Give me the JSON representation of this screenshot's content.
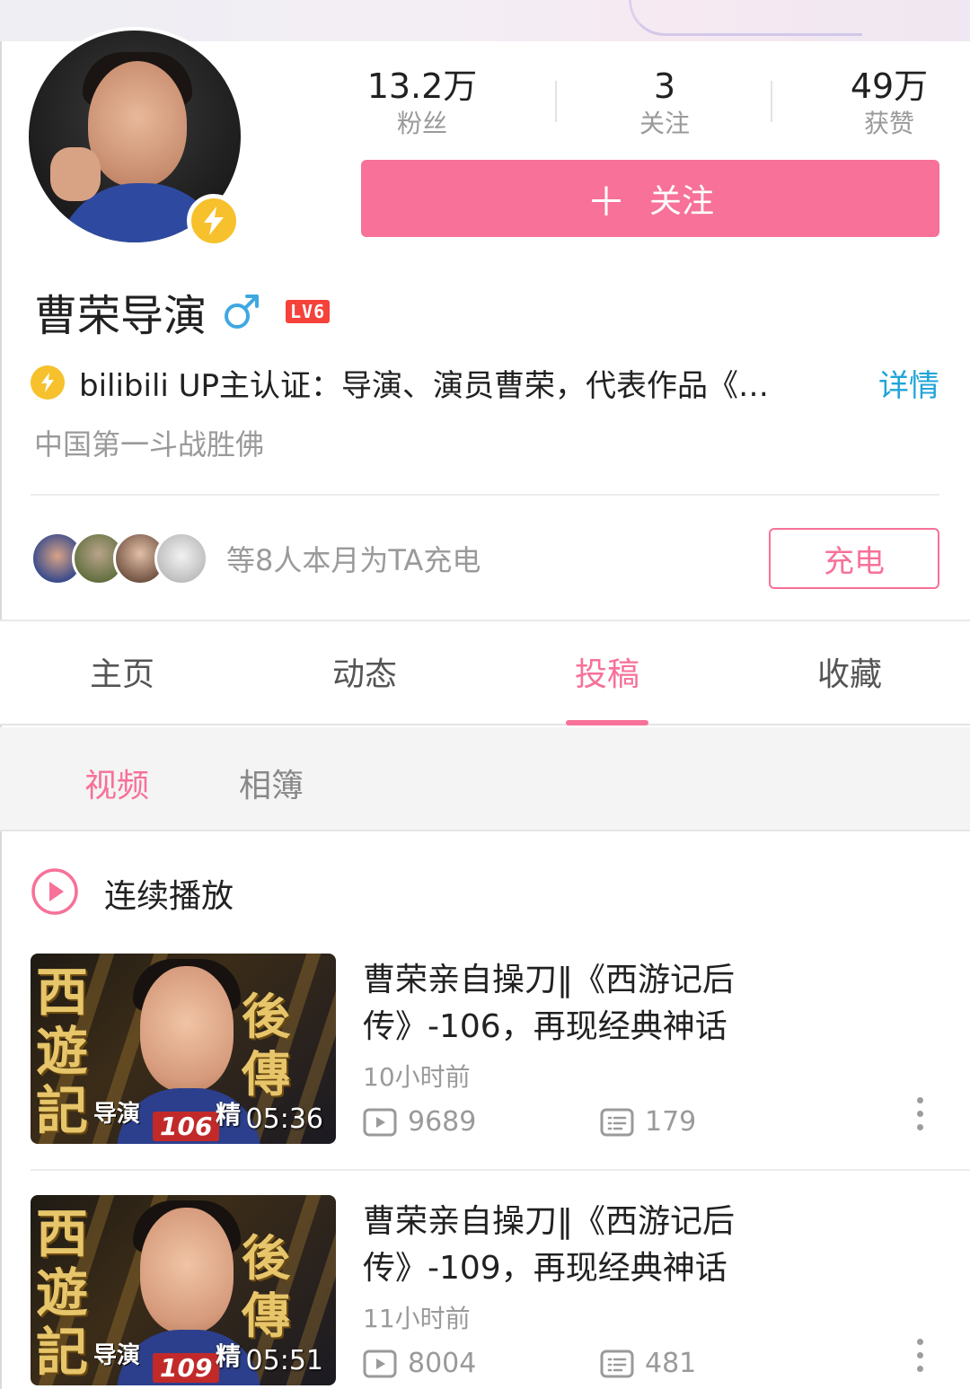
{
  "profile": {
    "name": "曹荣导演",
    "gender_icon": "male-icon",
    "level": "LV6",
    "avatar_text": "",
    "stats": [
      {
        "value": "13.2万",
        "label": "粉丝"
      },
      {
        "value": "3",
        "label": "关注"
      },
      {
        "value": "49万",
        "label": "获赞"
      }
    ],
    "follow_label": "关注",
    "verification": "bilibili UP主认证：导演、演员曹荣，代表作品《…",
    "verification_detail": "详情",
    "signature": "中国第一斗战胜佛",
    "charge_text": "等8人本月为TA充电",
    "charge_button": "充电"
  },
  "tabs": [
    {
      "label": "主页"
    },
    {
      "label": "动态"
    },
    {
      "label": "投稿"
    },
    {
      "label": "收藏"
    }
  ],
  "active_tab": "投稿",
  "subtabs": [
    {
      "label": "视频"
    },
    {
      "label": "相簿"
    }
  ],
  "autoplay_label": "连续播放",
  "videos": [
    {
      "title": "曹荣亲自操刀‖《西游记后传》-106，再现经典神话",
      "time": "10小时前",
      "plays": "9689",
      "comments": "179",
      "duration": "05:36",
      "thumb_ep": "106",
      "thumb_left": "西遊記",
      "thumb_right": "後傳",
      "thumb_director": "导演",
      "thumb_badge": "精"
    },
    {
      "title": "曹荣亲自操刀‖《西游记后传》-109，再现经典神话",
      "time": "11小时前",
      "plays": "8004",
      "comments": "481",
      "duration": "05:51",
      "thumb_ep": "109",
      "thumb_left": "西遊記",
      "thumb_right": "後傳",
      "thumb_director": "导演",
      "thumb_badge": "精"
    }
  ],
  "colors": {
    "accent": "#f77198",
    "link": "#21a4d9",
    "level_badge": "#f5423a",
    "up_badge": "#f6c12c",
    "muted_text": "#9a9a9a"
  }
}
